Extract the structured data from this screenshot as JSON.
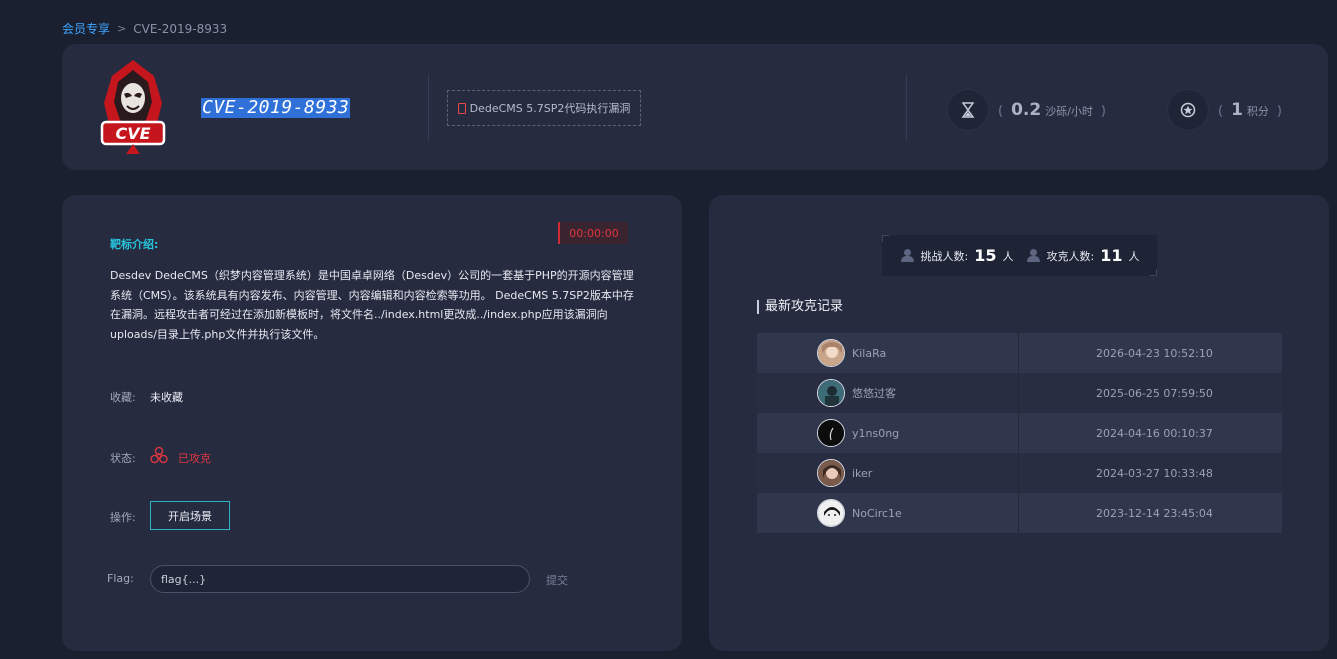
{
  "breadcrumb": {
    "parent": "会员专享",
    "separator": ">",
    "current": "CVE-2019-8933"
  },
  "header": {
    "logo_text": "CVE",
    "title": "CVE-2019-8933",
    "vuln_name": "DedeCMS 5.7SP2代码执行漏洞",
    "stats": [
      {
        "icon": "hourglass-icon",
        "value": "0.2",
        "unit": "沙砾/小时"
      },
      {
        "icon": "medal-icon",
        "value": "1",
        "unit": "积分"
      }
    ],
    "paren_open": "(",
    "paren_close": ")"
  },
  "target": {
    "label": "靶标介绍:",
    "timer": "00:00:00",
    "description": "Desdev DedeCMS（织梦内容管理系统）是中国卓卓网络（Desdev）公司的一套基于PHP的开源内容管理系统（CMS）。该系统具有内容发布、内容管理、内容编辑和内容检索等功用。 DedeCMS 5.7SP2版本中存在漏洞。远程攻击者可经过在添加新模板时，将文件名../index.html更改成../index.php应用该漏洞向uploads/目录上传.php文件并执行该文件。",
    "favorite_label": "收藏:",
    "favorite_value": "未收藏",
    "status_label": "状态:",
    "status_value": "已攻克",
    "action_label": "操作:",
    "start_button": "开启场景",
    "flag_label": "Flag:",
    "flag_placeholder": "flag{...}",
    "submit": "提交"
  },
  "records": {
    "challengers_label": "挑战人数:",
    "challengers_value": "15",
    "challengers_unit": "人",
    "solvers_label": "攻克人数:",
    "solvers_value": "11",
    "solvers_unit": "人",
    "title": "最新攻克记录",
    "rows": [
      {
        "name": "KilaRa",
        "time": "2026-04-23 10:52:10",
        "avatar_color": "#c9a68a"
      },
      {
        "name": "悠悠过客",
        "time": "2025-06-25 07:59:50",
        "avatar_color": "#3e6b78"
      },
      {
        "name": "y1ns0ng",
        "time": "2024-04-16 00:10:37",
        "avatar_color": "#0c0c0c"
      },
      {
        "name": "iker",
        "time": "2024-03-27 10:33:48",
        "avatar_color": "#7a5a4a"
      },
      {
        "name": "NoCirc1e",
        "time": "2023-12-14 23:45:04",
        "avatar_color": "#f0f0f0"
      }
    ]
  },
  "colors": {
    "accent_cyan": "#27c4dc",
    "status_red": "#e0353f",
    "link_blue": "#3fa5ff"
  }
}
